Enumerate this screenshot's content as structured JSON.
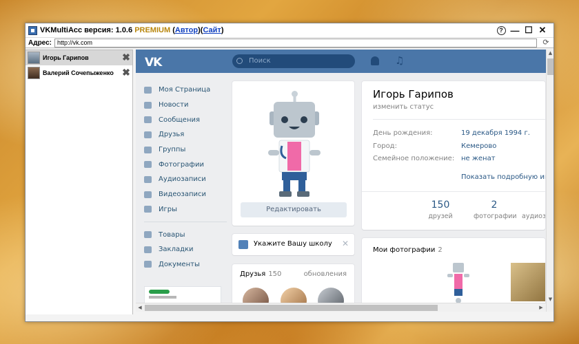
{
  "window": {
    "app_name": "VKMultiAcc версия: 1.0.6",
    "premium": "PREMIUM",
    "paren_open": "(",
    "author_link": "Автор",
    "paren_close_open": ")(",
    "site_link": "Сайт",
    "paren_close": ")",
    "controls": {
      "help": "?",
      "minimize": "—",
      "maximize": "☐",
      "close": "✕"
    }
  },
  "address": {
    "label": "Адрес:",
    "value": "http://vk.com"
  },
  "accounts": [
    {
      "name": "Игорь Гарипов",
      "active": true
    },
    {
      "name": "Валерий Сочепыженко",
      "active": false
    }
  ],
  "vk": {
    "logo": "VK",
    "search_placeholder": "Поиск",
    "menu": [
      {
        "label": "Моя Страница",
        "icon": "home-icon"
      },
      {
        "label": "Новости",
        "icon": "news-icon"
      },
      {
        "label": "Сообщения",
        "icon": "messages-icon"
      },
      {
        "label": "Друзья",
        "icon": "friends-icon"
      },
      {
        "label": "Группы",
        "icon": "groups-icon"
      },
      {
        "label": "Фотографии",
        "icon": "camera-icon"
      },
      {
        "label": "Аудиозаписи",
        "icon": "music-icon"
      },
      {
        "label": "Видеозаписи",
        "icon": "video-icon"
      },
      {
        "label": "Игры",
        "icon": "gamepad-icon"
      }
    ],
    "menu2": [
      {
        "label": "Товары",
        "icon": "bag-icon"
      },
      {
        "label": "Закладки",
        "icon": "star-icon"
      },
      {
        "label": "Документы",
        "icon": "document-icon"
      }
    ],
    "edit_button": "Редактировать",
    "school_prompt": "Укажите Вашу школу",
    "friends": {
      "title": "Друзья",
      "count": "150",
      "updates": "обновления"
    },
    "profile": {
      "name": "Игорь Гарипов",
      "status": "изменить статус",
      "rows": [
        {
          "key": "День рождения:",
          "value": "19 декабря 1994 г."
        },
        {
          "key": "Город:",
          "value": "Кемерово"
        },
        {
          "key": "Семейное положение:",
          "value": "не женат"
        }
      ],
      "more": "Показать подробную информацию",
      "stats": [
        {
          "num": "150",
          "label": "друзей"
        },
        {
          "num": "2",
          "label": "фотографии"
        },
        {
          "num": "",
          "label": "аудиозаписей"
        }
      ]
    },
    "photos": {
      "title": "Мои фотографии",
      "count": "2"
    }
  }
}
